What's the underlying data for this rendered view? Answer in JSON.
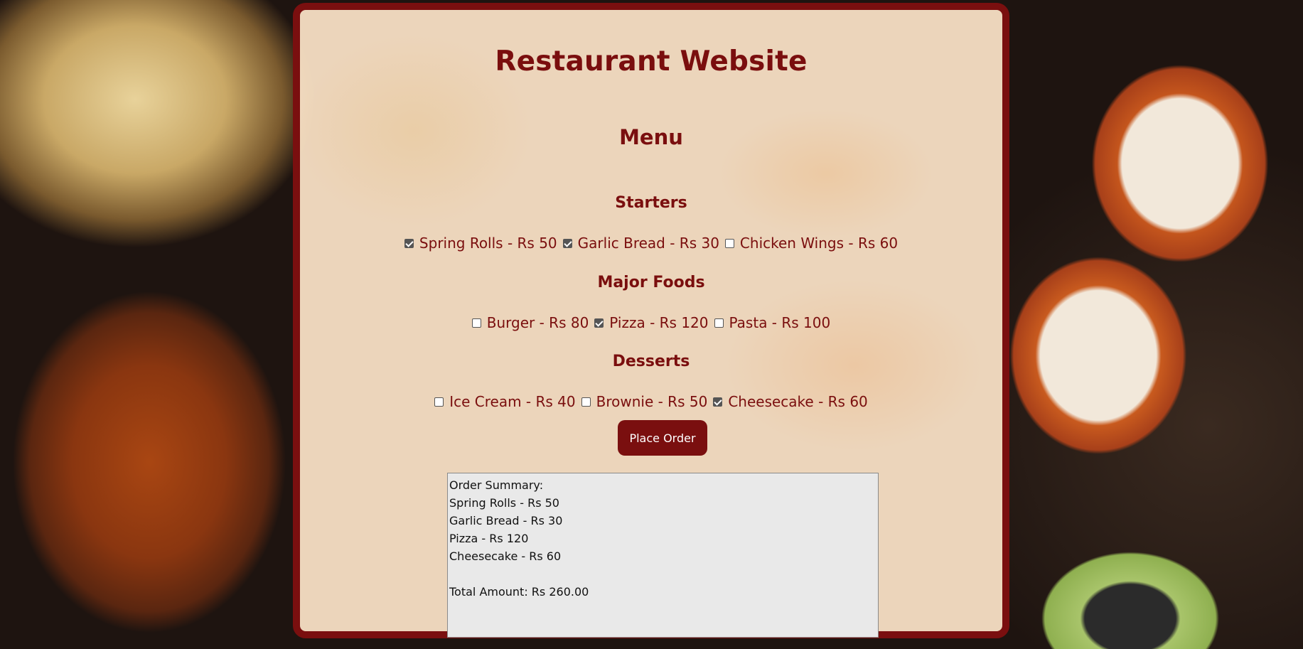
{
  "page": {
    "title": "Restaurant Website",
    "menu_heading": "Menu"
  },
  "sections": {
    "starters": {
      "heading": "Starters",
      "items": [
        {
          "label": "Spring Rolls - Rs 50",
          "checked": true
        },
        {
          "label": "Garlic Bread - Rs 30",
          "checked": true
        },
        {
          "label": "Chicken Wings - Rs 60",
          "checked": false
        }
      ]
    },
    "major": {
      "heading": "Major Foods",
      "items": [
        {
          "label": "Burger - Rs 80",
          "checked": false
        },
        {
          "label": "Pizza - Rs 120",
          "checked": true
        },
        {
          "label": "Pasta - Rs 100",
          "checked": false
        }
      ]
    },
    "desserts": {
      "heading": "Desserts",
      "items": [
        {
          "label": "Ice Cream - Rs 40",
          "checked": false
        },
        {
          "label": "Brownie - Rs 50",
          "checked": false
        },
        {
          "label": "Cheesecake - Rs 60",
          "checked": true
        }
      ]
    }
  },
  "order_button": {
    "label": "Place Order"
  },
  "summary": {
    "text": "Order Summary:\nSpring Rolls - Rs 50\nGarlic Bread - Rs 30\nPizza - Rs 120\nCheesecake - Rs 60\n\nTotal Amount: Rs 260.00"
  },
  "colors": {
    "accent": "#7a0f0f",
    "panel": "#fce4c8",
    "summary_bg": "#e9e9e9"
  }
}
